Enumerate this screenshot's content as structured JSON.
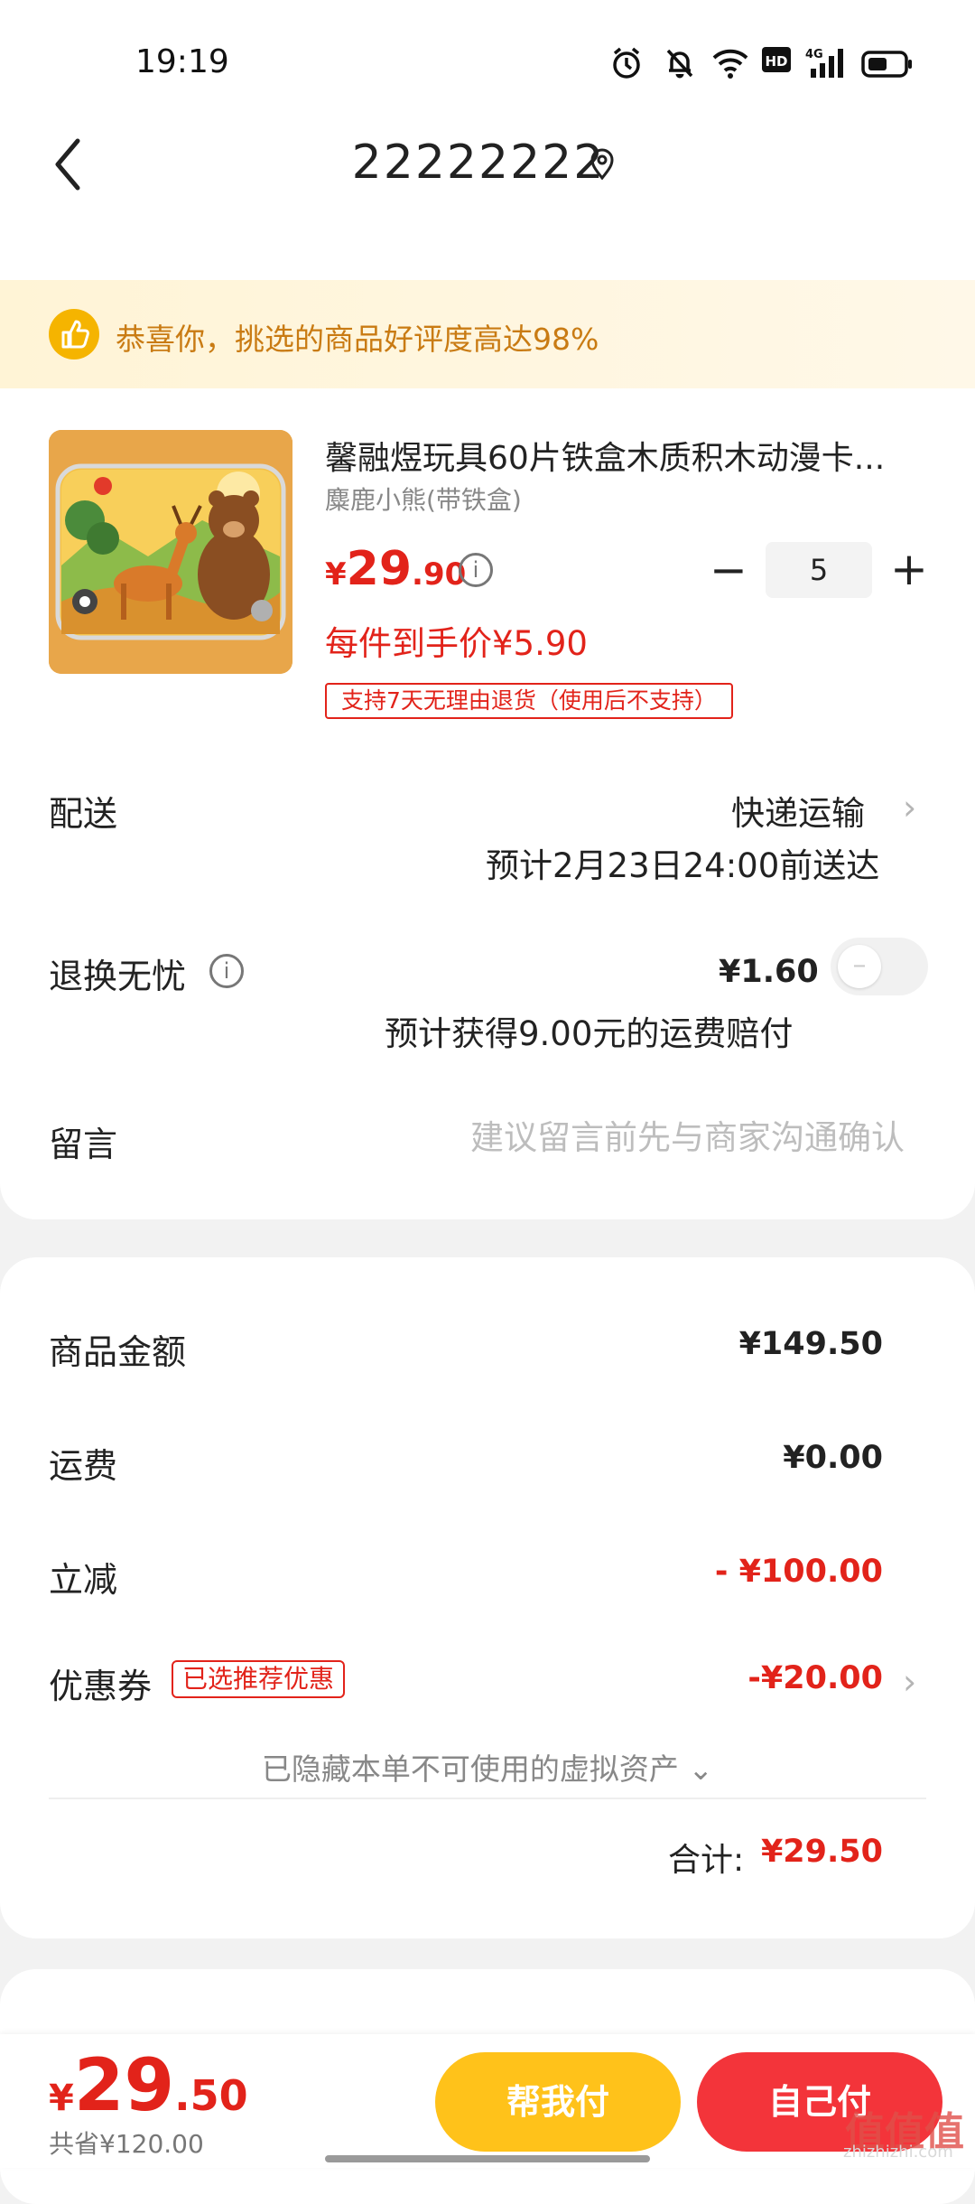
{
  "status_bar": {
    "time": "19:19",
    "hd": "HD",
    "net": "4G"
  },
  "header": {
    "title": "22222222"
  },
  "banner": {
    "text": "恭喜你，挑选的商品好评度高达98%"
  },
  "product": {
    "name": "馨融煜玩具60片铁盒木质积木动漫卡...",
    "sku": "麋鹿小熊(带铁盒)",
    "price_symbol": "¥",
    "price_int": "29",
    "price_dec": ".90",
    "quantity": "5",
    "per_item_price": "每件到手价¥5.90",
    "return_tag": "支持7天无理由退货（使用后不支持）"
  },
  "delivery": {
    "label": "配送",
    "method": "快递运输",
    "estimate": "预计2月23日24:00前送达"
  },
  "return_insurance": {
    "label": "退换无忧",
    "price": "¥1.60",
    "compensation": "预计获得9.00元的运费赔付",
    "enabled": false
  },
  "message": {
    "label": "留言",
    "placeholder": "建议留言前先与商家沟通确认"
  },
  "summary": {
    "goods_label": "商品金额",
    "goods_value": "¥149.50",
    "shipping_label": "运费",
    "shipping_value": "¥0.00",
    "discount_label": "立减",
    "discount_value": "- ¥100.00",
    "coupon_label": "优惠券",
    "coupon_tag": "已选推荐优惠",
    "coupon_value": "-¥20.00",
    "hidden_note": "已隐藏本单不可使用的虚拟资产 ⌄",
    "total_label": "合计:",
    "total_value": "¥29.50"
  },
  "bottom_bar": {
    "price_symbol": "¥",
    "price_int": "29",
    "price_dec": ".50",
    "saved": "共省¥120.00",
    "help_pay": "帮我付",
    "self_pay": "自己付"
  },
  "watermark": {
    "text": "值值值",
    "sub": "zhizhizhi.com"
  },
  "colors": {
    "accent_red": "#e2231a",
    "button_yellow": "#ffc21a",
    "button_red": "#f3343a",
    "banner_text": "#c97b13"
  }
}
